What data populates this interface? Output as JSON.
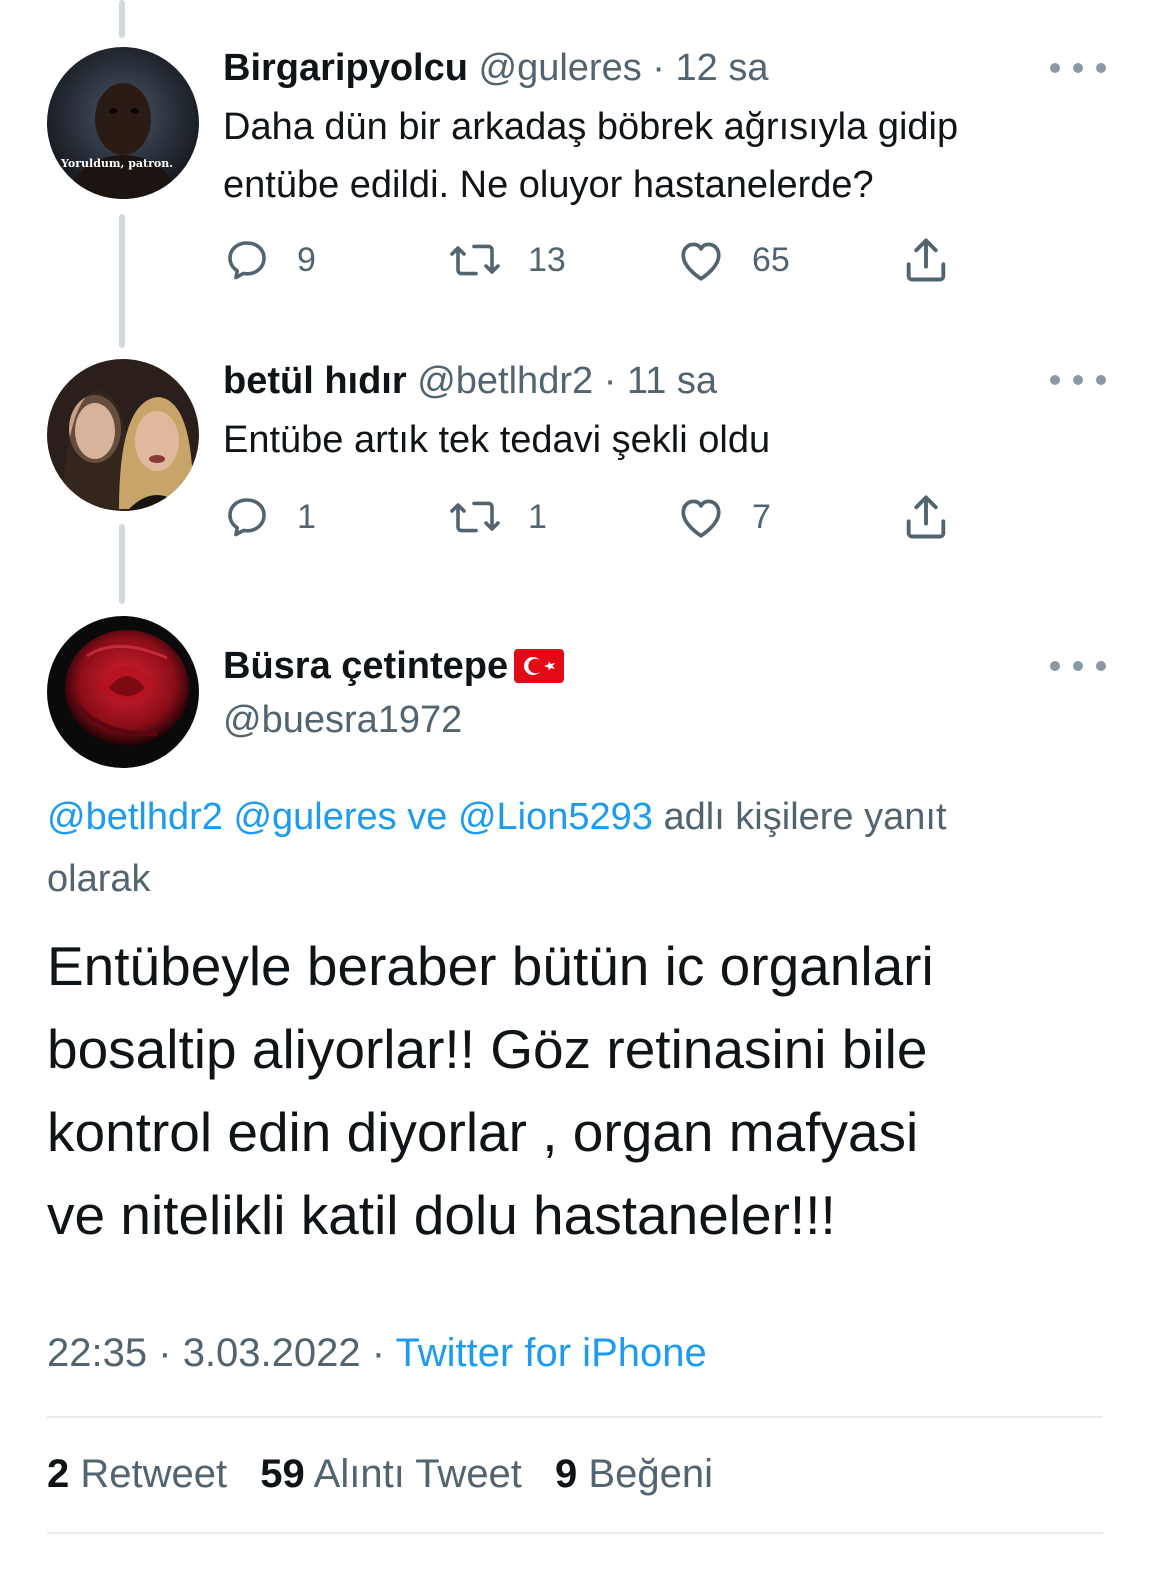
{
  "thread": [
    {
      "display_name": "Birgaripyolcu",
      "handle": "@guleres",
      "separator": "·",
      "time": "12 sa",
      "avatar_caption": "Yoruldum, patron.",
      "text_lines": [
        "Daha dün bir arkadaş böbrek ağrısıyla gidip",
        "entübe edildi. Ne oluyor hastanelerde?"
      ],
      "reply_count": "9",
      "retweet_count": "13",
      "like_count": "65"
    },
    {
      "display_name": "betül hıdır",
      "handle": "@betlhdr2",
      "separator": "·",
      "time": "11 sa",
      "text_lines": [
        "Entübe artık tek tedavi şekli oldu"
      ],
      "reply_count": "1",
      "retweet_count": "1",
      "like_count": "7"
    }
  ],
  "main_tweet": {
    "display_name": "Büsra çetintepe",
    "handle": "@buesra1972",
    "replying_mentions": [
      "@betlhdr2",
      "@guleres",
      "ve",
      "@Lion5293"
    ],
    "replying_suffix_line1": "adlı kişilere yanıt",
    "replying_suffix_line2": "olarak",
    "text_lines": [
      "Entübeyle beraber bütün ic organlari",
      "bosaltip aliyorlar!! Göz retinasini bile",
      "kontrol edin diyorlar , organ mafyasi",
      "ve nitelikli katil dolu hastaneler!!!"
    ],
    "time": "22:35",
    "separator": "·",
    "date": "3.03.2022",
    "source": "Twitter for iPhone",
    "retweets_count": "2",
    "retweets_label": "Retweet",
    "quotes_count": "59",
    "quotes_label": "Alıntı Tweet",
    "likes_count": "9",
    "likes_label": "Beğeni"
  },
  "icons": {
    "reply": "reply-icon",
    "retweet": "retweet-icon",
    "like": "heart-icon",
    "share": "share-icon",
    "more": "more-icon",
    "flag": "turkey-flag-icon"
  },
  "colors": {
    "accent": "#1d9bf0",
    "secondary_text": "#536471",
    "primary_text": "#0f1419",
    "thread_line": "#cfd9de"
  }
}
